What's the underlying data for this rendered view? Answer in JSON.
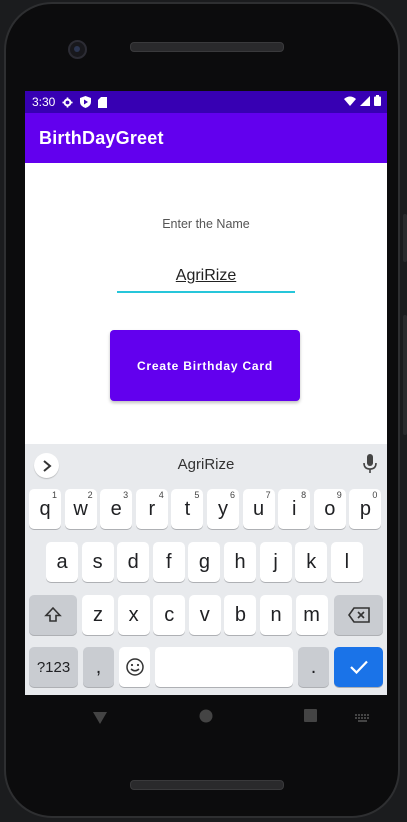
{
  "status_bar": {
    "time": "3:30",
    "icons": [
      "settings-gear-icon",
      "play-protect-icon",
      "sd-card-icon",
      "wifi-icon",
      "signal-icon",
      "battery-icon"
    ]
  },
  "app_bar": {
    "title": "BirthDayGreet"
  },
  "form": {
    "label": "Enter the Name",
    "name_value": "AgriRize",
    "button_label": "Create Birthday Card"
  },
  "keyboard": {
    "suggestion": "AgriRize",
    "row1": [
      {
        "key": "q",
        "hint": "1"
      },
      {
        "key": "w",
        "hint": "2"
      },
      {
        "key": "e",
        "hint": "3"
      },
      {
        "key": "r",
        "hint": "4"
      },
      {
        "key": "t",
        "hint": "5"
      },
      {
        "key": "y",
        "hint": "6"
      },
      {
        "key": "u",
        "hint": "7"
      },
      {
        "key": "i",
        "hint": "8"
      },
      {
        "key": "o",
        "hint": "9"
      },
      {
        "key": "p",
        "hint": "0"
      }
    ],
    "row2": [
      "a",
      "s",
      "d",
      "f",
      "g",
      "h",
      "j",
      "k",
      "l"
    ],
    "row3": [
      "z",
      "x",
      "c",
      "v",
      "b",
      "n",
      "m"
    ],
    "row4": {
      "symbols": "?123",
      "comma": ",",
      "period": "."
    }
  },
  "colors": {
    "status_bar": "#3700b3",
    "primary": "#6200ee",
    "input_underline": "#26c6da",
    "keyboard_bg": "#e8eaed",
    "enter_key": "#1a73e8"
  }
}
